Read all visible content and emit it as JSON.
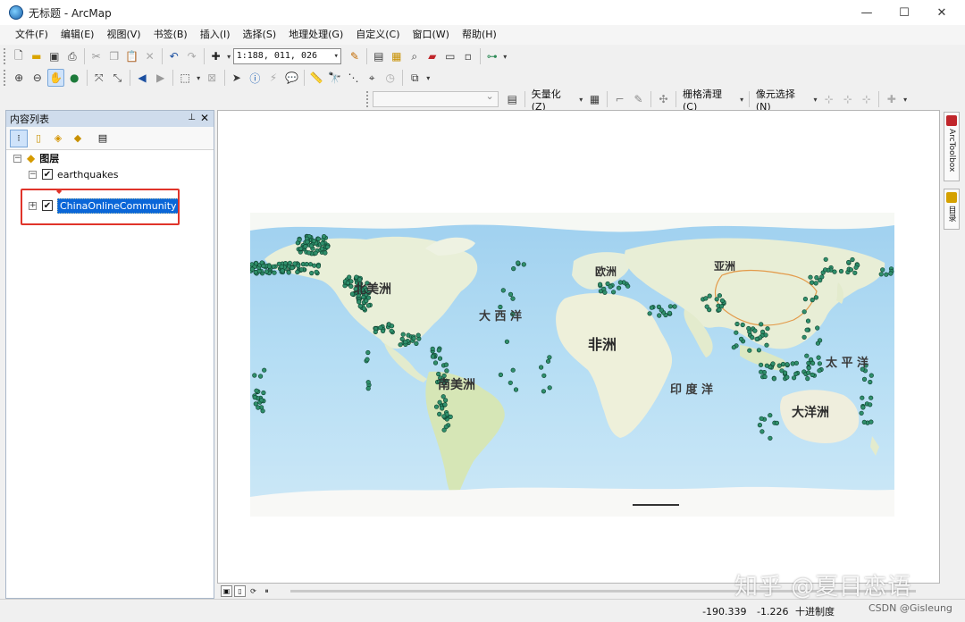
{
  "window": {
    "title": "无标题 - ArcMap",
    "controls": {
      "minimize": "—",
      "maximize": "☐",
      "close": "✕"
    }
  },
  "menubar": {
    "items": [
      "文件(F)",
      "编辑(E)",
      "视图(V)",
      "书签(B)",
      "插入(I)",
      "选择(S)",
      "地理处理(G)",
      "自定义(C)",
      "窗口(W)",
      "帮助(H)"
    ]
  },
  "standard_toolbar": {
    "scale_value": "1:188, 011, 026"
  },
  "editor_toolbar": {
    "vectorize_label": "矢量化(Z)",
    "raster_cleanup_label": "栅格清理(C)",
    "cell_select_label": "像元选择(N)"
  },
  "toc": {
    "title": "内容列表",
    "root_label": "图层",
    "layers": [
      {
        "name": "earthquakes",
        "checked": true,
        "expanded": true
      },
      {
        "name": "ChinaOnlineCommunity",
        "checked": true,
        "expanded": false,
        "selected": true
      }
    ]
  },
  "map": {
    "labels": [
      {
        "text": "北美洲"
      },
      {
        "text": "大 西 洋"
      },
      {
        "text": "欧洲"
      },
      {
        "text": "亚洲"
      },
      {
        "text": "非洲"
      },
      {
        "text": "南美洲"
      },
      {
        "text": "印 度 洋"
      },
      {
        "text": "太 平 洋"
      },
      {
        "text": "大洋洲"
      }
    ],
    "colors": {
      "ocean": "#aed6ef",
      "land": "#eef2e4",
      "point": "#2f8f6b",
      "highlight": "#e0342a"
    }
  },
  "right_dock": {
    "tabs": [
      "ArcToolbox",
      "目录"
    ]
  },
  "statusbar": {
    "x": "-190.339",
    "y": "-1.226",
    "units": "十进制度"
  },
  "overlay": {
    "watermark": "知乎 @夏目恋语",
    "csdn": "CSDN @Gisleung"
  }
}
